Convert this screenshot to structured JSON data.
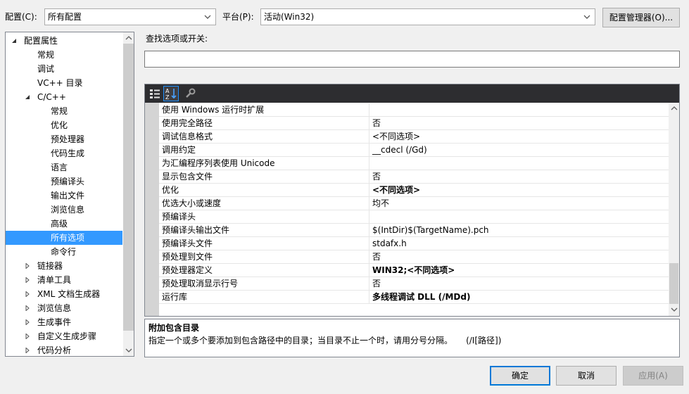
{
  "header": {
    "config_label": "配置(C):",
    "config_value": "所有配置",
    "platform_label": "平台(P):",
    "platform_value": "活动(Win32)",
    "config_manager_button": "配置管理器(O)..."
  },
  "tree": {
    "items": [
      {
        "label": "配置属性",
        "expander": "expanded",
        "level": 0,
        "selected": false
      },
      {
        "label": "常规",
        "expander": "none",
        "level": 1,
        "selected": false
      },
      {
        "label": "调试",
        "expander": "none",
        "level": 1,
        "selected": false
      },
      {
        "label": "VC++ 目录",
        "expander": "none",
        "level": 1,
        "selected": false
      },
      {
        "label": "C/C++",
        "expander": "expanded",
        "level": 1,
        "selected": false
      },
      {
        "label": "常规",
        "expander": "none",
        "level": 2,
        "selected": false
      },
      {
        "label": "优化",
        "expander": "none",
        "level": 2,
        "selected": false
      },
      {
        "label": "预处理器",
        "expander": "none",
        "level": 2,
        "selected": false
      },
      {
        "label": "代码生成",
        "expander": "none",
        "level": 2,
        "selected": false
      },
      {
        "label": "语言",
        "expander": "none",
        "level": 2,
        "selected": false
      },
      {
        "label": "预编译头",
        "expander": "none",
        "level": 2,
        "selected": false
      },
      {
        "label": "输出文件",
        "expander": "none",
        "level": 2,
        "selected": false
      },
      {
        "label": "浏览信息",
        "expander": "none",
        "level": 2,
        "selected": false
      },
      {
        "label": "高级",
        "expander": "none",
        "level": 2,
        "selected": false
      },
      {
        "label": "所有选项",
        "expander": "none",
        "level": 2,
        "selected": true
      },
      {
        "label": "命令行",
        "expander": "none",
        "level": 2,
        "selected": false
      },
      {
        "label": "链接器",
        "expander": "collapsed",
        "level": 1,
        "selected": false
      },
      {
        "label": "清单工具",
        "expander": "collapsed",
        "level": 1,
        "selected": false
      },
      {
        "label": "XML 文档生成器",
        "expander": "collapsed",
        "level": 1,
        "selected": false
      },
      {
        "label": "浏览信息",
        "expander": "collapsed",
        "level": 1,
        "selected": false
      },
      {
        "label": "生成事件",
        "expander": "collapsed",
        "level": 1,
        "selected": false
      },
      {
        "label": "自定义生成步骤",
        "expander": "collapsed",
        "level": 1,
        "selected": false
      },
      {
        "label": "代码分析",
        "expander": "collapsed",
        "level": 1,
        "selected": false
      }
    ]
  },
  "search": {
    "label": "查找选项或开关:",
    "value": ""
  },
  "toolbar": {
    "categorized_icon": "categorized-view-icon",
    "alphabetical_icon": "alphabetical-sort-icon",
    "property_pages_icon": "wrench-icon"
  },
  "properties": [
    {
      "name": "使用 Windows 运行时扩展",
      "value": "",
      "bold": false
    },
    {
      "name": "使用完全路径",
      "value": "否",
      "bold": false
    },
    {
      "name": "调试信息格式",
      "value": "<不同选项>",
      "bold": false
    },
    {
      "name": "调用约定",
      "value": "__cdecl (/Gd)",
      "bold": false
    },
    {
      "name": "为汇编程序列表使用 Unicode",
      "value": "",
      "bold": false
    },
    {
      "name": "显示包含文件",
      "value": "否",
      "bold": false
    },
    {
      "name": "优化",
      "value": "<不同选项>",
      "bold": true
    },
    {
      "name": "优选大小或速度",
      "value": "均不",
      "bold": false
    },
    {
      "name": "预编译头",
      "value": "",
      "bold": false
    },
    {
      "name": "预编译头输出文件",
      "value": "$(IntDir)$(TargetName).pch",
      "bold": false
    },
    {
      "name": "预编译头文件",
      "value": "stdafx.h",
      "bold": false
    },
    {
      "name": "预处理到文件",
      "value": "否",
      "bold": false
    },
    {
      "name": "预处理器定义",
      "value": "WIN32;<不同选项>",
      "bold": true
    },
    {
      "name": "预处理取消显示行号",
      "value": "否",
      "bold": false
    },
    {
      "name": "运行库",
      "value": "多线程调试 DLL (/MDd)",
      "bold": true
    }
  ],
  "description": {
    "title": "附加包含目录",
    "text": "指定一个或多个要添加到包含路径中的目录；当目录不止一个时，请用分号分隔。     (/I[路径])"
  },
  "footer": {
    "ok": "确定",
    "cancel": "取消",
    "apply": "应用(A)"
  },
  "colors": {
    "selection": "#3399ff",
    "toolbar_bg": "#2d2d30",
    "toolbar_icon_active": "#1e90ff",
    "primary_border": "#0078d7"
  }
}
